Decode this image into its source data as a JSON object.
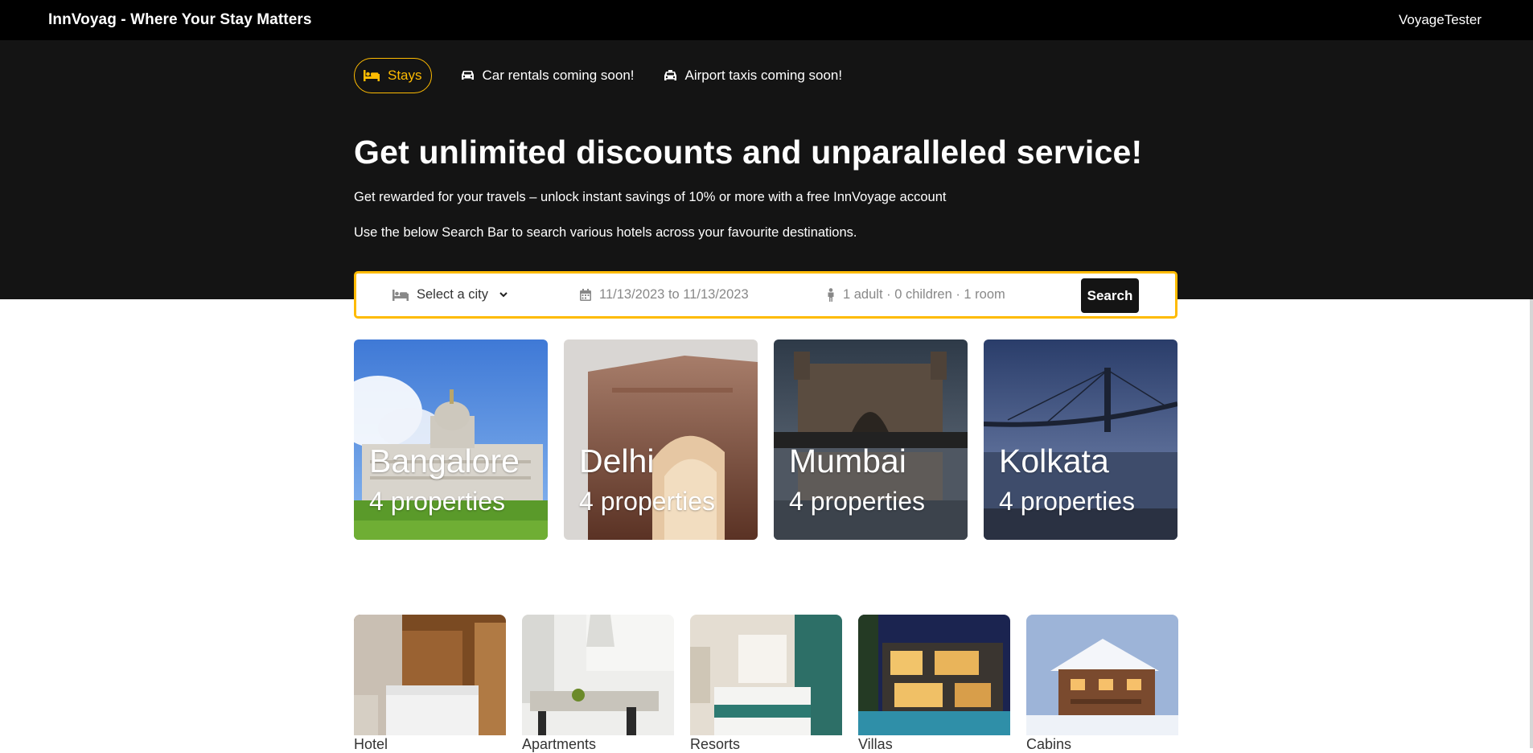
{
  "app": {
    "brand": "InnVoyag - Where Your Stay Matters",
    "user": "VoyageTester"
  },
  "tabs": [
    {
      "label": "Stays",
      "icon": "bed-icon",
      "active": true
    },
    {
      "label": "Car rentals coming soon!",
      "icon": "car-icon",
      "active": false
    },
    {
      "label": "Airport taxis coming soon!",
      "icon": "taxi-icon",
      "active": false
    }
  ],
  "hero": {
    "title": "Get unlimited discounts and unparalleled service!",
    "subtitle1": "Get rewarded for your travels – unlock instant savings of 10% or more with a free InnVoyage account",
    "subtitle2": "Use the below Search Bar to search various hotels across your favourite destinations."
  },
  "search": {
    "city_label": "Select a city",
    "dates": "11/13/2023 to 11/13/2023",
    "guests": "1 adult · 0 children · 1 room",
    "button": "Search"
  },
  "cities": [
    {
      "name": "Bangalore",
      "count": "4 properties"
    },
    {
      "name": "Delhi",
      "count": "4 properties"
    },
    {
      "name": "Mumbai",
      "count": "4 properties"
    },
    {
      "name": "Kolkata",
      "count": "4 properties"
    }
  ],
  "property_types": [
    {
      "label": "Hotel"
    },
    {
      "label": "Apartments"
    },
    {
      "label": "Resorts"
    },
    {
      "label": "Villas"
    },
    {
      "label": "Cabins"
    }
  ],
  "colors": {
    "accent": "#febb02",
    "hero_bg": "#141414",
    "topbar_bg": "#000000"
  }
}
